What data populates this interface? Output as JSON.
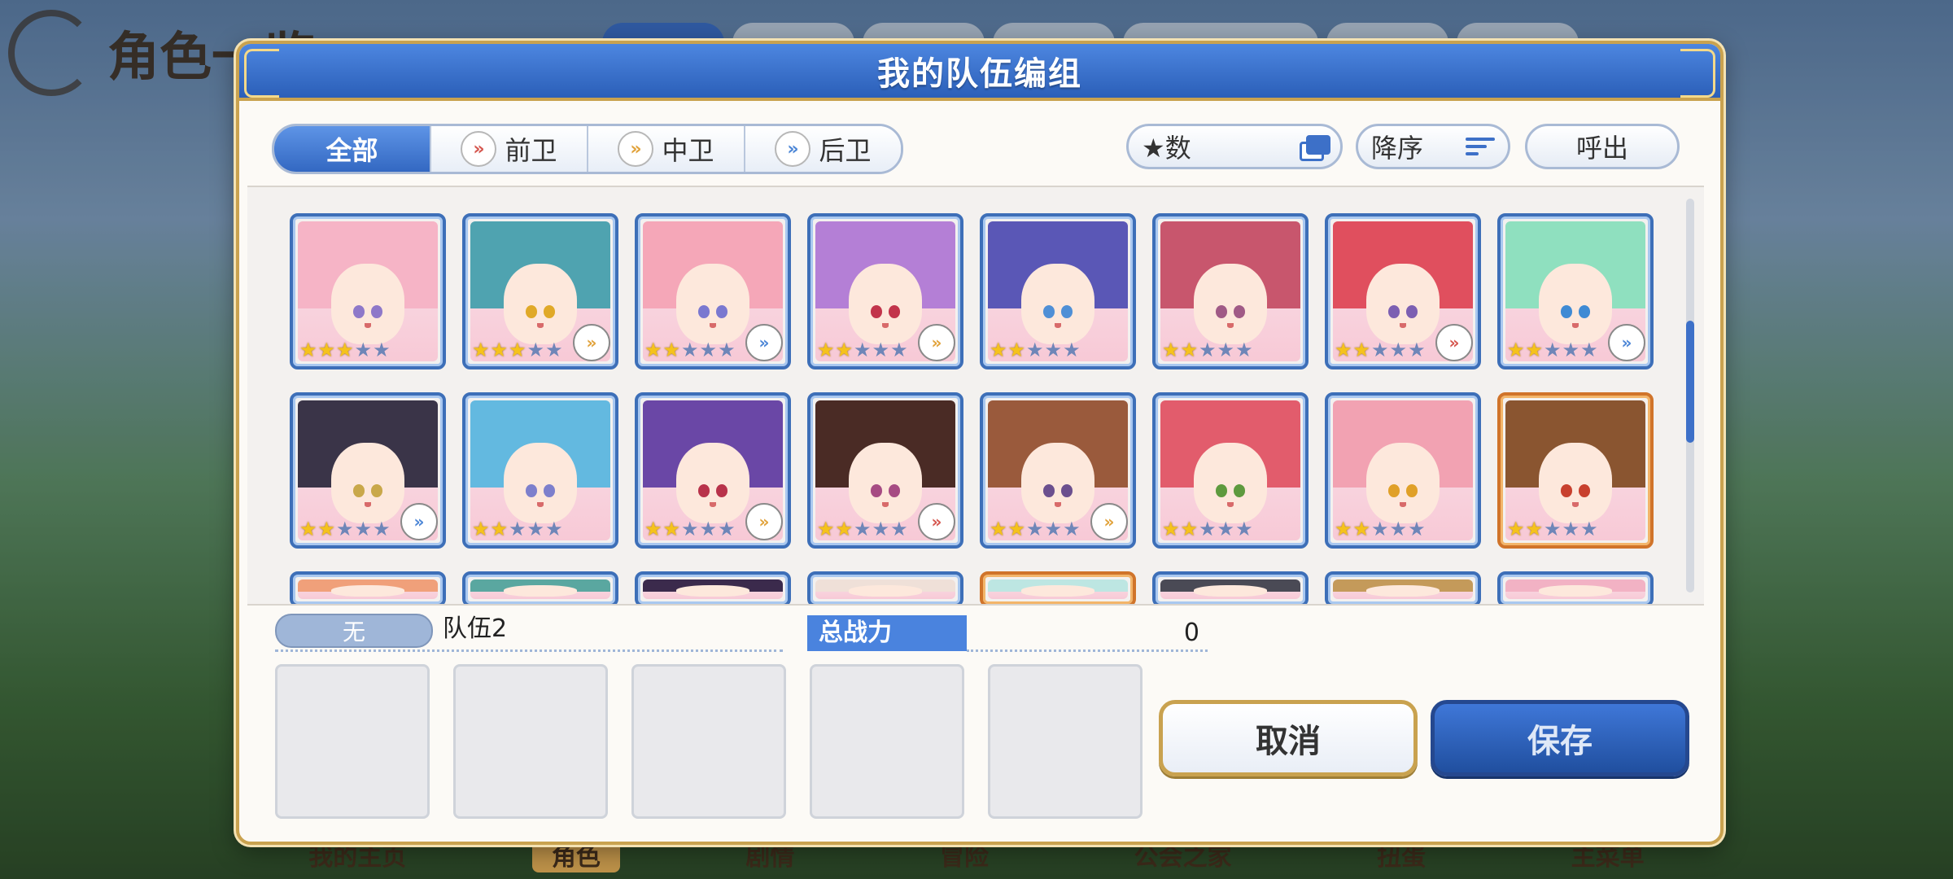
{
  "background": {
    "title": "角色一览",
    "nav": [
      "我的主页",
      "角色",
      "剧情",
      "冒险",
      "公会之家",
      "扭蛋",
      "主菜单"
    ],
    "active_nav": 1
  },
  "dialog": {
    "title": "我的队伍编组",
    "filter_tabs": [
      {
        "label": "全部",
        "icon": "",
        "active": true
      },
      {
        "label": "前卫",
        "icon": "front-role-icon",
        "active": false
      },
      {
        "label": "中卫",
        "icon": "mid-role-icon",
        "active": false
      },
      {
        "label": "后卫",
        "icon": "back-role-icon",
        "active": false
      }
    ],
    "star_sort_label": "★数",
    "sort_order_label": "降序",
    "call_out_label": "呼出",
    "role_glyph": "»",
    "characters": [
      {
        "stars": 3,
        "max": 5,
        "role": "",
        "hair": "#f6b4c6",
        "eye": "#8e78c9",
        "frame": "blue"
      },
      {
        "stars": 3,
        "max": 5,
        "role": "mid",
        "hair": "#4fa3b0",
        "eye": "#e0a928",
        "frame": "blue"
      },
      {
        "stars": 2,
        "max": 5,
        "role": "back",
        "hair": "#f5a7b8",
        "eye": "#7a78d0",
        "frame": "blue"
      },
      {
        "stars": 2,
        "max": 5,
        "role": "mid",
        "hair": "#b47fd6",
        "eye": "#c2344b",
        "frame": "blue"
      },
      {
        "stars": 2,
        "max": 5,
        "role": "",
        "hair": "#5a57b6",
        "eye": "#4f8fd6",
        "frame": "blue"
      },
      {
        "stars": 2,
        "max": 5,
        "role": "",
        "hair": "#c8566d",
        "eye": "#a05a86",
        "frame": "blue"
      },
      {
        "stars": 2,
        "max": 5,
        "role": "front",
        "hair": "#e04f5e",
        "eye": "#7c5fb2",
        "frame": "blue"
      },
      {
        "stars": 2,
        "max": 5,
        "role": "back",
        "hair": "#8fe0bf",
        "eye": "#3f8ad4",
        "frame": "blue"
      },
      {
        "stars": 2,
        "max": 5,
        "role": "back",
        "hair": "#3a3448",
        "eye": "#c9a84a",
        "frame": "blue"
      },
      {
        "stars": 2,
        "max": 5,
        "role": "",
        "hair": "#63b9e0",
        "eye": "#7d7fcc",
        "frame": "blue"
      },
      {
        "stars": 2,
        "max": 5,
        "role": "mid",
        "hair": "#6a47a6",
        "eye": "#b8324a",
        "frame": "blue"
      },
      {
        "stars": 2,
        "max": 5,
        "role": "front",
        "hair": "#4a2b25",
        "eye": "#a64b83",
        "frame": "blue"
      },
      {
        "stars": 2,
        "max": 5,
        "role": "mid",
        "hair": "#9a5a3c",
        "eye": "#6b4f8e",
        "frame": "blue"
      },
      {
        "stars": 2,
        "max": 5,
        "role": "",
        "hair": "#e25c6c",
        "eye": "#5e9a3e",
        "frame": "blue"
      },
      {
        "stars": 2,
        "max": 5,
        "role": "",
        "hair": "#f2a2b2",
        "eye": "#e0a028",
        "frame": "blue"
      },
      {
        "stars": 2,
        "max": 5,
        "role": "",
        "hair": "#8a5530",
        "eye": "#c8402e",
        "frame": "orange"
      }
    ],
    "partial_row": [
      {
        "hair": "#f0a07a",
        "frame": "blue"
      },
      {
        "hair": "#5aa7a0",
        "frame": "blue"
      },
      {
        "hair": "#3b2a4c",
        "frame": "blue"
      },
      {
        "hair": "#efe0d8",
        "frame": "blue"
      },
      {
        "hair": "#bde6e2",
        "frame": "orange"
      },
      {
        "hair": "#4a4a55",
        "frame": "blue"
      },
      {
        "hair": "#c49a5a",
        "frame": "blue"
      },
      {
        "hair": "#f2b2c4",
        "frame": "blue"
      }
    ],
    "team": {
      "badge": "无",
      "name": "队伍2",
      "power_label": "总战力",
      "power_value": "0"
    },
    "cancel_label": "取消",
    "save_label": "保存"
  }
}
